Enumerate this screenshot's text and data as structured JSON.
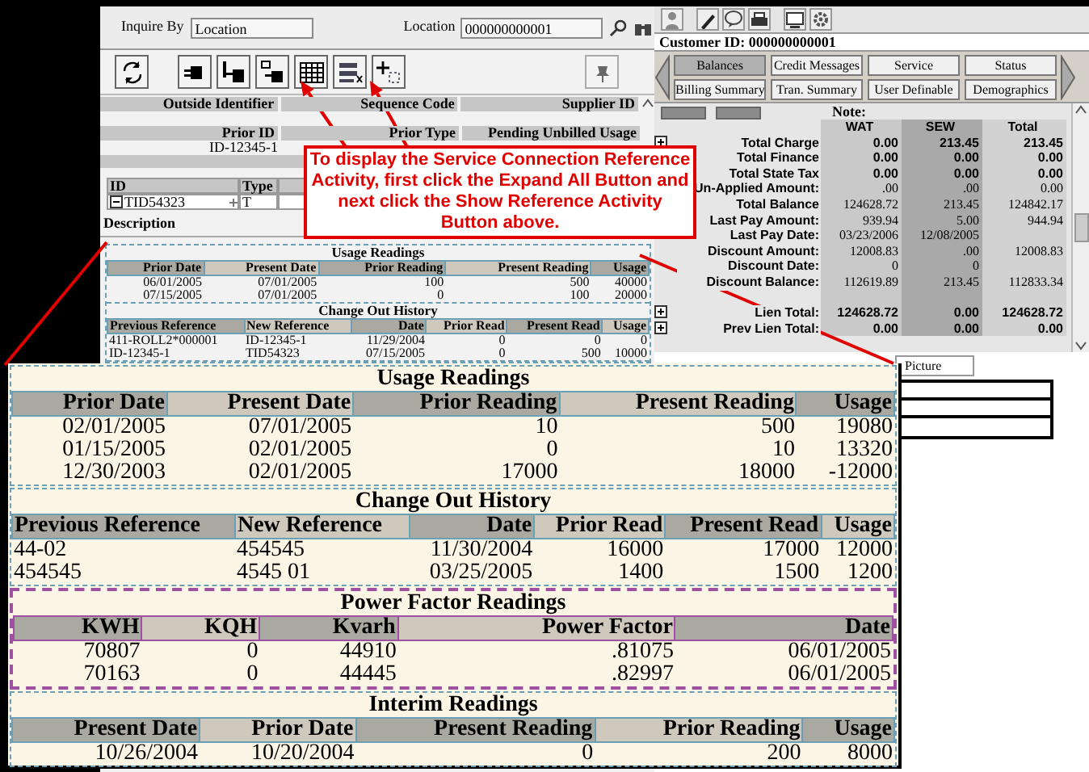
{
  "inquiry": {
    "inquire_by": {
      "label": "Inquire By",
      "value": "Location"
    },
    "location": {
      "label": "Location",
      "value": "000000000001"
    }
  },
  "detail_grid": {
    "header_rows": [
      [
        "Outside Identifier",
        "Sequence Code",
        "Supplier ID"
      ],
      [
        "Prior ID",
        "Prior Type",
        "Pending Unbilled Usage"
      ]
    ],
    "prior_id": "ID-12345-1"
  },
  "id_table": {
    "columns": [
      "ID",
      "Type"
    ],
    "rows": [
      {
        "expanded": true,
        "id": "TID54323",
        "type": "T"
      }
    ]
  },
  "description_label": "Description",
  "mini_sections": [
    {
      "title": "Usage Readings",
      "color": "#6a9fb5",
      "columns": [
        {
          "label": "Prior Date",
          "kind": "number"
        },
        {
          "label": "Present Date",
          "kind": "number"
        },
        {
          "label": "Prior Reading",
          "kind": "number"
        },
        {
          "label": "Present Reading",
          "kind": "number"
        },
        {
          "label": "Usage",
          "kind": "number"
        }
      ],
      "rows": [
        [
          "06/01/2005",
          "07/01/2005",
          "100",
          "500",
          "40000"
        ],
        [
          "07/15/2005",
          "07/01/2005",
          "0",
          "100",
          "20000"
        ]
      ]
    },
    {
      "title": "Change Out History",
      "color": "#6a9fb5",
      "columns": [
        {
          "label": "Previous Reference",
          "kind": "text"
        },
        {
          "label": "New Reference",
          "kind": "text"
        },
        {
          "label": "Date",
          "kind": "number"
        },
        {
          "label": "Prior Read",
          "kind": "number"
        },
        {
          "label": "Present Read",
          "kind": "number"
        },
        {
          "label": "Usage",
          "kind": "number"
        }
      ],
      "rows": [
        [
          "411-ROLL2*000001",
          "ID-12345-1",
          "11/29/2004",
          "0",
          "0",
          "0"
        ],
        [
          "ID-12345-1",
          "TID54323",
          "07/15/2005",
          "0",
          "500",
          "10000"
        ]
      ]
    }
  ],
  "callout": "To display the Service Connection Reference Activity, first click the Expand All Button and next click the Show Reference Activity Button above.",
  "account": {
    "customer_id": "Customer ID: 000000000001",
    "tab_rows": [
      [
        {
          "label": "Balances",
          "selected": true
        },
        {
          "label": "Credit Messages",
          "selected": false
        },
        {
          "label": "Service",
          "selected": false
        },
        {
          "label": "Status",
          "selected": false
        }
      ],
      [
        {
          "label": "Billing Summary",
          "selected": false
        },
        {
          "label": "Tran. Summary",
          "selected": false
        },
        {
          "label": "User Definable",
          "selected": false
        },
        {
          "label": "Demographics",
          "selected": false
        }
      ]
    ],
    "note_label": "Note:",
    "columns": [
      "WAT",
      "SEW",
      "Total"
    ],
    "row_groups": [
      [
        {
          "label": "Total Charge",
          "kind": "total",
          "expandable": true,
          "values": [
            "0.00",
            "213.45",
            "213.45"
          ]
        },
        {
          "label": "Total Finance",
          "kind": "total",
          "values": [
            "0.00",
            "0.00",
            "0.00"
          ]
        },
        {
          "label": "Total State Tax",
          "kind": "total",
          "values": [
            "0.00",
            "0.00",
            "0.00"
          ]
        },
        {
          "label": "Un-Applied Amount:",
          "kind": "amount",
          "values": [
            ".00",
            ".00",
            "0.00"
          ]
        },
        {
          "label": "Total Balance",
          "kind": "amount",
          "values": [
            "124628.72",
            "213.45",
            "124842.17"
          ]
        },
        {
          "label": "Last Pay Amount:",
          "kind": "amount",
          "values": [
            "939.94",
            "5.00",
            "944.94"
          ]
        },
        {
          "label": "Last Pay Date:",
          "kind": "amount",
          "expandable": false,
          "values": [
            "03/23/2006",
            "12/08/2005"
          ]
        },
        {
          "label": "Discount Amount:",
          "kind": "amount",
          "expandable": false,
          "values": [
            "12008.83",
            ".00",
            "12008.83"
          ]
        },
        {
          "label": "Discount Date:",
          "kind": "amount",
          "expandable": false,
          "values": [
            "0",
            "0"
          ]
        },
        {
          "label": "Discount Balance:",
          "kind": "amount",
          "expandable": false,
          "values": [
            "112619.89",
            "213.45",
            "112833.34"
          ]
        }
      ],
      [
        {
          "label": "Lien Total:",
          "kind": "total",
          "expandable": true,
          "values": [
            "124628.72",
            "0.00",
            "124628.72"
          ]
        },
        {
          "label": "Prev Lien Total:",
          "kind": "total",
          "expandable": true,
          "values": [
            "0.00",
            "0.00",
            "0.00"
          ]
        }
      ]
    ],
    "bottom_tabs": [
      {
        "label": "Picture",
        "selected": false
      }
    ]
  },
  "zoom_sections": [
    {
      "title": "Usage Readings",
      "color": "#6a9fb5",
      "columns": [
        {
          "label": "Prior Date",
          "kind": "number"
        },
        {
          "label": "Present Date",
          "kind": "number"
        },
        {
          "label": "Prior Reading",
          "kind": "number"
        },
        {
          "label": "Present Reading",
          "kind": "number"
        },
        {
          "label": "Usage",
          "kind": "number"
        }
      ],
      "rows": [
        [
          "02/01/2005",
          "07/01/2005",
          "10",
          "500",
          "19080"
        ],
        [
          "01/15/2005",
          "02/01/2005",
          "0",
          "10",
          "13320"
        ],
        [
          "12/30/2003",
          "02/01/2005",
          "17000",
          "18000",
          "-12000"
        ]
      ]
    },
    {
      "title": "Change Out History",
      "color": "#6a9fb5",
      "columns": [
        {
          "label": "Previous Reference",
          "kind": "text"
        },
        {
          "label": "New Reference",
          "kind": "text"
        },
        {
          "label": "Date",
          "kind": "number"
        },
        {
          "label": "Prior Read",
          "kind": "number"
        },
        {
          "label": "Present Read",
          "kind": "number"
        },
        {
          "label": "Usage",
          "kind": "number"
        }
      ],
      "rows": [
        [
          "44-02",
          "454545",
          "11/30/2004",
          "16000",
          "17000",
          "12000"
        ],
        [
          "454545",
          "4545  01",
          "03/25/2005",
          "1400",
          "1500",
          "1200"
        ]
      ]
    },
    {
      "title": "Power Factor Readings",
      "color": "#a050a0",
      "columns": [
        {
          "label": "KWH",
          "kind": "number"
        },
        {
          "label": "KQH",
          "kind": "number"
        },
        {
          "label": "Kvarh",
          "kind": "number"
        },
        {
          "label": "Power Factor",
          "kind": "number"
        },
        {
          "label": "Date",
          "kind": "number"
        }
      ],
      "rows": [
        [
          "70807",
          "0",
          "44910",
          ".81075",
          "06/01/2005"
        ],
        [
          "70163",
          "0",
          "44445",
          ".82997",
          "06/01/2005"
        ]
      ]
    },
    {
      "title": "Interim Readings",
      "color": "#6a9fb5",
      "columns": [
        {
          "label": "Present Date",
          "kind": "number"
        },
        {
          "label": "Prior Date",
          "kind": "number"
        },
        {
          "label": "Present Reading",
          "kind": "number"
        },
        {
          "label": "Prior Reading",
          "kind": "number"
        },
        {
          "label": "Usage",
          "kind": "number"
        }
      ],
      "rows": [
        [
          "10/26/2004",
          "10/20/2004",
          "0",
          "200",
          "8000"
        ]
      ]
    }
  ]
}
